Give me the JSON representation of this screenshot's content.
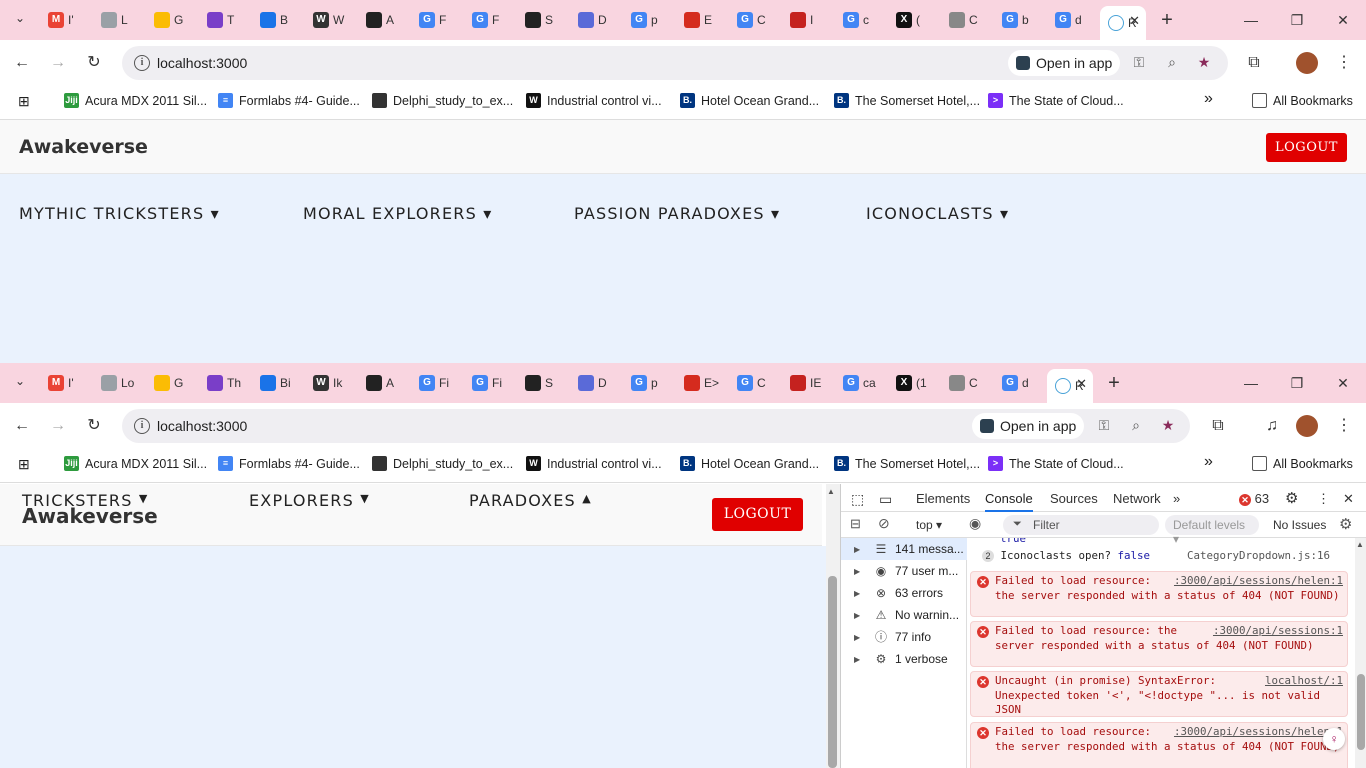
{
  "browser_top": {
    "tabs": [
      {
        "title": "I'",
        "color": "#ea4335",
        "glyph": "M"
      },
      {
        "title": "L",
        "color": "#9aa0a6",
        "glyph": ""
      },
      {
        "title": "G",
        "color": "#fbbc04",
        "glyph": ""
      },
      {
        "title": "T",
        "color": "#7a3ec8",
        "glyph": ""
      },
      {
        "title": "B",
        "color": "#1a73e8",
        "glyph": ""
      },
      {
        "title": "W",
        "color": "#333333",
        "glyph": "W"
      },
      {
        "title": "A",
        "color": "#222222",
        "glyph": ""
      },
      {
        "title": "F",
        "color": "#4285f4",
        "glyph": "G"
      },
      {
        "title": "F",
        "color": "#4285f4",
        "glyph": "G"
      },
      {
        "title": "S",
        "color": "#222222",
        "glyph": ""
      },
      {
        "title": "D",
        "color": "#5a6ad8",
        "glyph": ""
      },
      {
        "title": "p",
        "color": "#4285f4",
        "glyph": "G"
      },
      {
        "title": "E",
        "color": "#d52b1e",
        "glyph": ""
      },
      {
        "title": "C",
        "color": "#4285f4",
        "glyph": "G"
      },
      {
        "title": "I",
        "color": "#c5221f",
        "glyph": ""
      },
      {
        "title": "c",
        "color": "#4285f4",
        "glyph": "G"
      },
      {
        "title": "(",
        "color": "#111111",
        "glyph": "X"
      },
      {
        "title": "C",
        "color": "#888888",
        "glyph": ""
      },
      {
        "title": "b",
        "color": "#4285f4",
        "glyph": "G"
      },
      {
        "title": "d",
        "color": "#4285f4",
        "glyph": "G"
      }
    ],
    "active_tab": "R",
    "url": "localhost:3000",
    "open_in_app": "Open in app"
  },
  "browser_bottom": {
    "tabs": [
      {
        "title": "I'",
        "color": "#ea4335",
        "glyph": "M"
      },
      {
        "title": "Lo",
        "color": "#9aa0a6",
        "glyph": ""
      },
      {
        "title": "G",
        "color": "#fbbc04",
        "glyph": ""
      },
      {
        "title": "Th",
        "color": "#7a3ec8",
        "glyph": ""
      },
      {
        "title": "Bi",
        "color": "#1a73e8",
        "glyph": ""
      },
      {
        "title": "Ik",
        "color": "#333333",
        "glyph": "W"
      },
      {
        "title": "A",
        "color": "#222222",
        "glyph": ""
      },
      {
        "title": "Fi",
        "color": "#4285f4",
        "glyph": "G"
      },
      {
        "title": "Fi",
        "color": "#4285f4",
        "glyph": "G"
      },
      {
        "title": "S",
        "color": "#222222",
        "glyph": ""
      },
      {
        "title": "D",
        "color": "#5a6ad8",
        "glyph": ""
      },
      {
        "title": "p",
        "color": "#4285f4",
        "glyph": "G"
      },
      {
        "title": "E>",
        "color": "#d52b1e",
        "glyph": ""
      },
      {
        "title": "C",
        "color": "#4285f4",
        "glyph": "G"
      },
      {
        "title": "IE",
        "color": "#c5221f",
        "glyph": ""
      },
      {
        "title": "ca",
        "color": "#4285f4",
        "glyph": "G"
      },
      {
        "title": "(1",
        "color": "#111111",
        "glyph": "X"
      },
      {
        "title": "C",
        "color": "#888888",
        "glyph": ""
      },
      {
        "title": "d",
        "color": "#4285f4",
        "glyph": "G"
      }
    ],
    "active_tab": "R",
    "url": "localhost:3000",
    "open_in_app": "Open in app"
  },
  "bookmarks": {
    "items": [
      {
        "label": "Acura MDX 2011 Sil...",
        "color": "#2e9b3e",
        "glyph": "Jiji"
      },
      {
        "label": "Formlabs #4- Guide...",
        "color": "#4285f4",
        "glyph": "≡"
      },
      {
        "label": "Delphi_study_to_ex...",
        "color": "#333333",
        "glyph": ""
      },
      {
        "label": "Industrial control vi...",
        "color": "#111111",
        "glyph": "W"
      },
      {
        "label": "Hotel Ocean Grand...",
        "color": "#003580",
        "glyph": "B."
      },
      {
        "label": "The Somerset Hotel,...",
        "color": "#003580",
        "glyph": "B."
      },
      {
        "label": "The State of Cloud...",
        "color": "#7b2ff7",
        "glyph": ">"
      }
    ],
    "all_bookmarks": "All Bookmarks",
    "more": "»"
  },
  "app": {
    "logo": "Awakeverse",
    "logout": "LOGOUT",
    "categories": [
      "MYTHIC TRICKSTERS ▾",
      "MORAL EXPLORERS ▾",
      "PASSION PARADOXES ▾",
      "ICONOCLASTS ▾"
    ],
    "narrow_categories": [
      {
        "line1": "TRICKSTERS",
        "arrow": "▼"
      },
      {
        "line1": "EXPLORERS",
        "arrow": "▼"
      },
      {
        "line1": "PARADOXES",
        "arrow": "▲"
      }
    ]
  },
  "devtools": {
    "tabs": [
      "Elements",
      "Console",
      "Sources",
      "Network"
    ],
    "active_tab": "Console",
    "error_count": "63",
    "context": "top",
    "filter_placeholder": "Filter",
    "levels": "Default levels",
    "issues": "No Issues",
    "sidebar": [
      {
        "label": "141 messa...",
        "icon": "☰"
      },
      {
        "label": "77 user m...",
        "icon": "◉"
      },
      {
        "label": "63 errors",
        "icon": "⊗"
      },
      {
        "label": "No warnin...",
        "icon": "⚠"
      },
      {
        "label": "77 info",
        "icon": "ⓘ"
      },
      {
        "label": "1 verbose",
        "icon": "⚙"
      }
    ],
    "log_true": "true",
    "log_count": "2",
    "log_text": "Iconoclasts open? ",
    "log_value": "false",
    "log_src": "CategoryDropdown.js:16",
    "errors": [
      {
        "text": "Failed to load resource: the server responded with a status of 404 (NOT FOUND)",
        "src": ":3000/api/sessions/helen:1"
      },
      {
        "text": "Failed to load resource: the server responded with a status of 404 (NOT FOUND)",
        "src": ":3000/api/sessions:1"
      },
      {
        "text": "Uncaught (in promise) SyntaxError: Unexpected token '<', \"<!doctype \"... is not valid JSON",
        "src": "localhost/:1"
      },
      {
        "text": "Failed to load resource: the server responded with a status of 404 (NOT FOUND)",
        "src": ":3000/api/sessions/helen:1"
      }
    ]
  }
}
